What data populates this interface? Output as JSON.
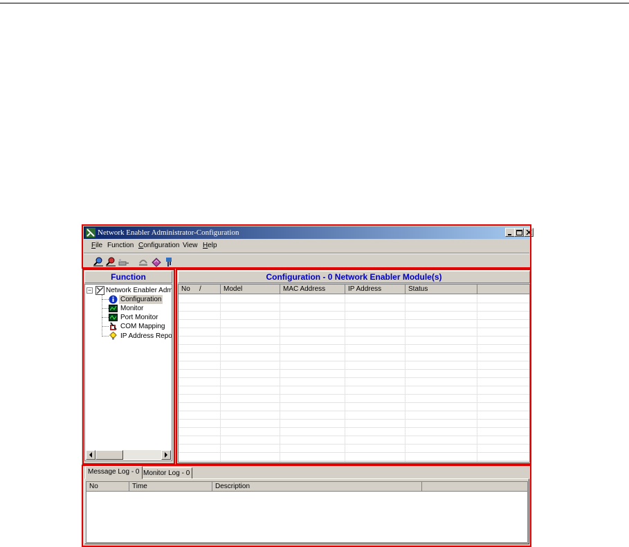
{
  "window": {
    "title": "Network Enabler Administrator-Configuration"
  },
  "menu": [
    {
      "label": "File",
      "underline": "F",
      "rest": "ile"
    },
    {
      "label": "Function",
      "underline": "",
      "rest": "Function"
    },
    {
      "label": "Configuration",
      "underline": "C",
      "rest": "onfiguration"
    },
    {
      "label": "View",
      "underline": "",
      "rest": "View"
    },
    {
      "label": "Help",
      "underline": "H",
      "rest": "elp"
    }
  ],
  "toolbar_icons": [
    "search-device-icon",
    "search-ip-icon",
    "unlock-icon",
    "broadcast-icon",
    "eraser-icon",
    "com-port-icon"
  ],
  "function_panel": {
    "header": "Function",
    "tree_root": "Network Enabler Admi",
    "items": [
      "Configuration",
      "Monitor",
      "Port Monitor",
      "COM Mapping",
      "IP Address Report"
    ],
    "selected_item": "Configuration"
  },
  "config_panel": {
    "header": "Configuration - 0 Network Enabler Module(s)",
    "columns": [
      "No",
      "Model",
      "MAC Address",
      "IP Address",
      "Status",
      ""
    ],
    "sort_indicator": "/",
    "rows": []
  },
  "log_panel": {
    "tabs": [
      "Message Log - 0",
      "Monitor Log - 0"
    ],
    "active_tab": "Message Log - 0",
    "columns": [
      "No",
      "Time",
      "Description",
      ""
    ],
    "rows": []
  },
  "colors": {
    "highlight_box": "#e00000",
    "panel_header_text": "#0000c0",
    "title_gradient_start": "#0a246a",
    "title_gradient_end": "#a6caf0"
  }
}
